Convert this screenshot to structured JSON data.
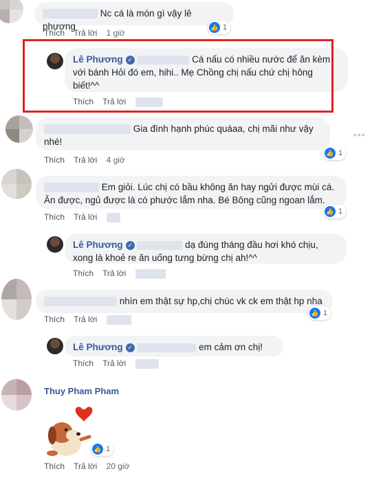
{
  "colors": {
    "link": "#385898",
    "highlight": "#e02020",
    "like": "#1877f2"
  },
  "comments": [
    {
      "text": "Nc cá là món gì vậy lê phương",
      "like": "Thích",
      "reply": "Trả lời",
      "time": "1 giờ",
      "reactions": "1"
    },
    {
      "name": "Lê Phương",
      "text": "Cá nấu có nhiều nước để ăn kèm với bánh Hỏi đó em, hihi.. Mẹ Chồng chị nấu chứ chị hông biết!^^",
      "like": "Thích",
      "reply": "Trả lời"
    },
    {
      "text": "Gia đình hạnh phúc quáaa, chị mãi như vậy nhé!",
      "like": "Thích",
      "reply": "Trả lời",
      "time": "4 giờ",
      "reactions": "1"
    },
    {
      "text": "Em giỏi. Lúc chị có bầu không ăn hay ngửi được mùi cá. Ăn được, ngủ được là có phước lắm nha. Bé Bông cũng ngoan lắm.",
      "like": "Thích",
      "reply": "Trả lời",
      "reactions": "1"
    },
    {
      "name": "Lê Phương",
      "text": "dạ đúng tháng đầu hơi khó chịu, xong là khoẻ re ăn uống tưng bừng chị ah!^^",
      "like": "Thích",
      "reply": "Trả lời"
    },
    {
      "text": "nhìn em thật sự hp,chị chúc vk ck em thật hp nha",
      "like": "Thích",
      "reply": "Trả lời",
      "reactions": "1"
    },
    {
      "name": "Lê Phương",
      "text": "em cảm ơn chị!",
      "like": "Thích",
      "reply": "Trả lời"
    },
    {
      "name": "Thuy Pham Pham",
      "like": "Thích",
      "reply": "Trả lời",
      "time": "20 giờ",
      "reactions": "1"
    }
  ],
  "icons": {
    "like": "thumbs-up-icon",
    "verified": "verified-badge-icon",
    "more": "more-options-icon",
    "sticker": "dog-heart-sticker"
  }
}
